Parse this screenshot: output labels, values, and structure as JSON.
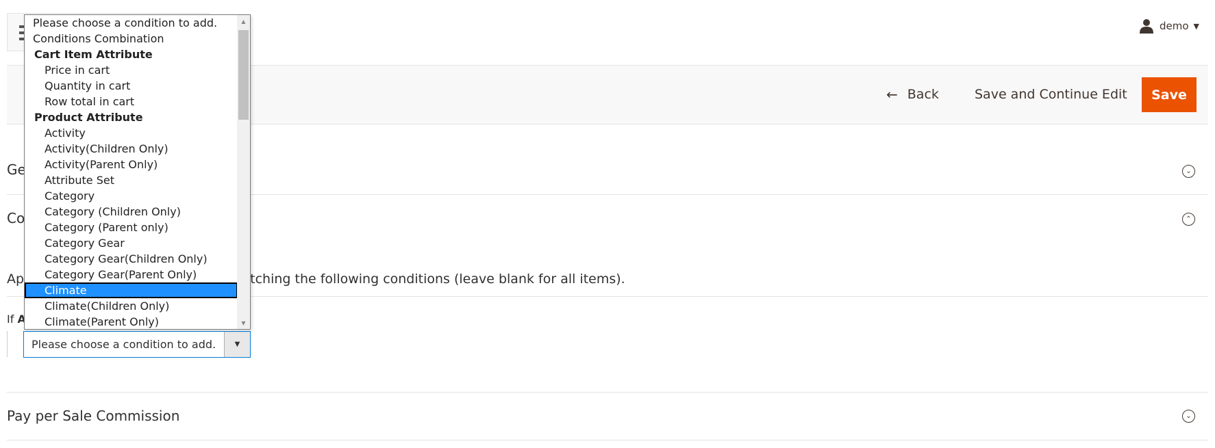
{
  "header": {
    "user_name": "demo",
    "user_icon": "user-icon",
    "menu_icon": "menu-icon"
  },
  "actions": {
    "back_label": "Back",
    "save_continue_label": "Save and Continue Edit",
    "save_label": "Save",
    "save_color": "#eb5202"
  },
  "sections": {
    "general_visible": "Ge",
    "conditions_visible": "Co",
    "commission_title": "Pay per Sale Commission"
  },
  "conditions": {
    "apply_prefix_visible": "Ap",
    "apply_suffix_visible": "s matching the following conditions (leave blank for all items).",
    "if_prefix": "If",
    "if_bold_visible": "A",
    "select_value": "Please choose a condition to add."
  },
  "dropdown": {
    "options": [
      {
        "label": "Please choose a condition to add.",
        "kind": "top"
      },
      {
        "label": "Conditions Combination",
        "kind": "top"
      },
      {
        "label": "Cart Item Attribute",
        "kind": "group"
      },
      {
        "label": "Price in cart",
        "kind": "item"
      },
      {
        "label": "Quantity in cart",
        "kind": "item"
      },
      {
        "label": "Row total in cart",
        "kind": "item"
      },
      {
        "label": "Product Attribute",
        "kind": "group"
      },
      {
        "label": "Activity",
        "kind": "item"
      },
      {
        "label": "Activity(Children Only)",
        "kind": "item"
      },
      {
        "label": "Activity(Parent Only)",
        "kind": "item"
      },
      {
        "label": "Attribute Set",
        "kind": "item"
      },
      {
        "label": "Category",
        "kind": "item"
      },
      {
        "label": "Category (Children Only)",
        "kind": "item"
      },
      {
        "label": "Category (Parent only)",
        "kind": "item"
      },
      {
        "label": "Category Gear",
        "kind": "item"
      },
      {
        "label": "Category Gear(Children Only)",
        "kind": "item"
      },
      {
        "label": "Category Gear(Parent Only)",
        "kind": "item"
      },
      {
        "label": "Climate",
        "kind": "item",
        "selected": true
      },
      {
        "label": "Climate(Children Only)",
        "kind": "item"
      },
      {
        "label": "Climate(Parent Only)",
        "kind": "item"
      }
    ],
    "highlight_color": "#1e90ff"
  }
}
